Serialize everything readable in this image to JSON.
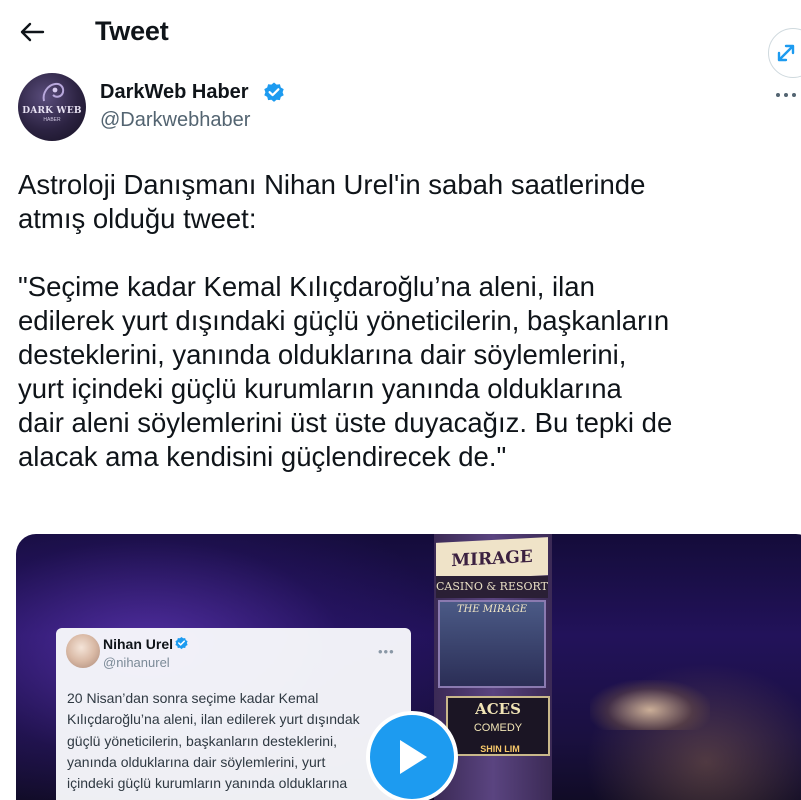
{
  "header": {
    "title": "Tweet"
  },
  "author": {
    "name": "DarkWeb Haber",
    "handle": "@Darkwebhaber",
    "avatar_text": "DARK WEB",
    "avatar_sub": "HABER",
    "verified": true
  },
  "tweet": {
    "text": "Astroloji Danışmanı Nihan Urel'in sabah saatlerinde\natmış olduğu tweet:\n\n\"Seçime kadar Kemal Kılıçdaroğlu’na aleni, ilan\nedilerek yurt dışındaki güçlü yöneticilerin, başkanların\ndesteklerini, yanında olduklarına dair söylemlerini,\nyurt içindeki güçlü kurumların yanında olduklarına\ndair aleni söylemlerini üst üste duyacağız. Bu tepki de\nalacak ama kendisini güçlendirecek de.\""
  },
  "media": {
    "type": "video",
    "signs": {
      "mirage": "MIRAGE",
      "casino": "CASINO & RESORT",
      "screen": "THE MIRAGE",
      "aces": "ACES",
      "comedy": "COMEDY",
      "shin": "SHIN LIM"
    },
    "embedded_tweet": {
      "name": "Nihan Urel",
      "handle": "@nihanurel",
      "text": "20 Nisan’dan sonra seçime kadar Kemal\nKılıçdaroğlu’na aleni, ilan edilerek yurt dışındak\ngüçlü yöneticilerin, başkanların desteklerini,\nyanında olduklarına dair söylemlerini, yurt\niçindeki güçlü kurumların yanında olduklarına"
    }
  },
  "colors": {
    "accent": "#1d9bf0",
    "text": "#0f1419",
    "secondary": "#536471"
  },
  "icons": {
    "back": "arrow-left-icon",
    "expand": "expand-arrows-icon",
    "verified": "verified-badge-icon",
    "more": "more-horizontal-icon",
    "play": "play-icon"
  }
}
